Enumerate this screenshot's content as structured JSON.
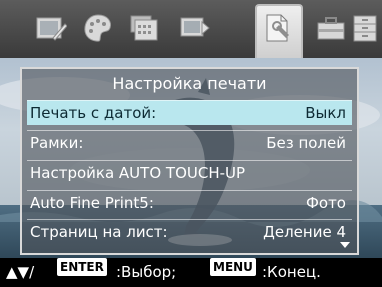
{
  "toolbar": {
    "icons": [
      "image-edit-icon",
      "palette-icon",
      "calendar-icon",
      "slideshow-icon",
      "settings-sheet-icon",
      "toolbox-icon",
      "storage-icon"
    ],
    "selected_icon": "settings-sheet-icon"
  },
  "menu": {
    "title": "Настройка печати",
    "rows": [
      {
        "label": "Печать с датой:",
        "value": "Выкл"
      },
      {
        "label": "Рамки:",
        "value": "Без полей"
      },
      {
        "label": "Настройка AUTO TOUCH-UP",
        "value": ""
      },
      {
        "label": "Auto Fine Print5:",
        "value": "Фото"
      },
      {
        "label": "Страниц на лист:",
        "value": "Деление 4"
      }
    ],
    "selected_row_index": 0
  },
  "hint": {
    "arrows": "▲▼/",
    "enter_key": "ENTER",
    "enter_text": ":Выбор;",
    "menu_key": "MENU",
    "menu_text": ":Конец."
  },
  "colors": {
    "selection": "#b9e7ee",
    "panel_border": "#d9d9d9",
    "hint_bg": "#000000"
  }
}
